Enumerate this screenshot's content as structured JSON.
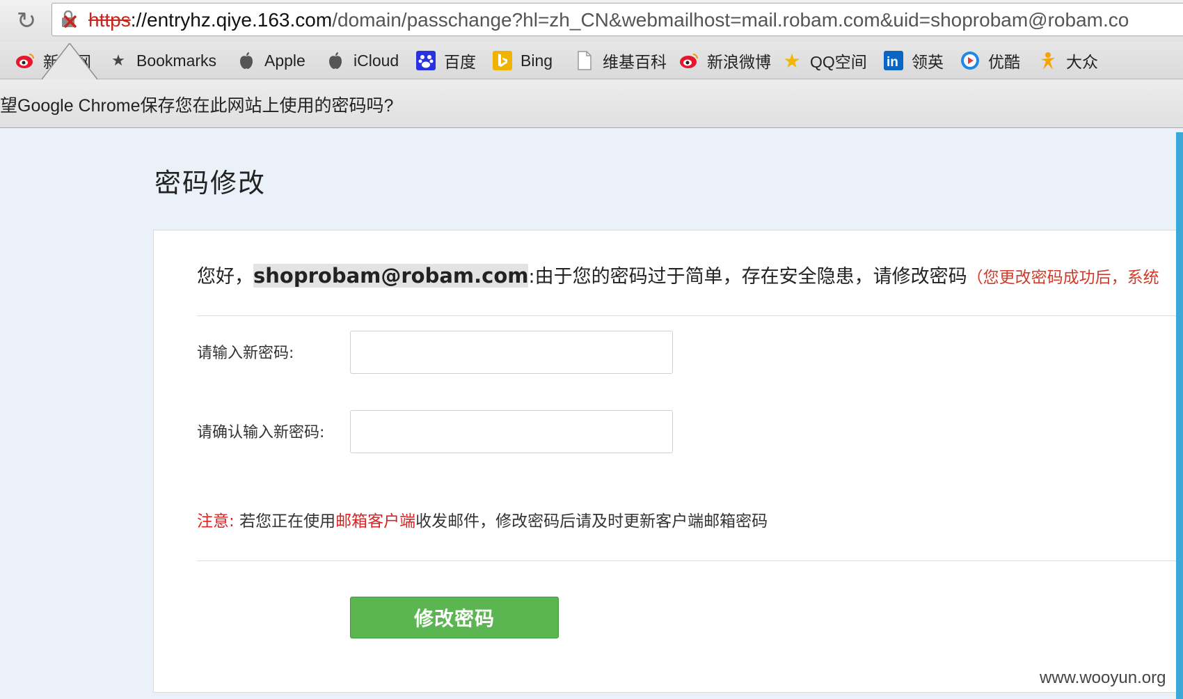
{
  "browser": {
    "url": {
      "scheme": "https",
      "host": "://entryhz.qiye.163.com",
      "path": "/domain/passchange?hl=zh_CN&webmailhost=mail.robam.com&uid=shoprobam@robam.co"
    },
    "bookmarks": [
      {
        "label": "新浪网",
        "icon": "weibo-icon"
      },
      {
        "label": "Bookmarks",
        "icon": "star-icon"
      },
      {
        "label": "Apple",
        "icon": "apple-icon"
      },
      {
        "label": "iCloud",
        "icon": "apple-icon"
      },
      {
        "label": "百度",
        "icon": "baidu-paw-icon"
      },
      {
        "label": "Bing",
        "icon": "bing-icon"
      },
      {
        "label": "维基百科",
        "icon": "page-icon"
      },
      {
        "label": "新浪微博",
        "icon": "weibo-icon"
      },
      {
        "label": "QQ空间",
        "icon": "qzone-star-icon"
      },
      {
        "label": "领英",
        "icon": "linkedin-icon"
      },
      {
        "label": "优酷",
        "icon": "youku-icon"
      },
      {
        "label": "大众",
        "icon": "person-icon"
      }
    ],
    "infobar_text": "望Google Chrome保存您在此网站上使用的密码吗?"
  },
  "page": {
    "title": "密码修改",
    "greeting_prefix": "您好，",
    "email": "shoprobam@robam.com",
    "greeting_suffix": ":由于您的密码过于简单，存在安全隐患，请修改密码",
    "greeting_note": "（您更改密码成功后，系统",
    "new_password_label": "请输入新密码:",
    "confirm_password_label": "请确认输入新密码:",
    "new_password_value": "",
    "confirm_password_value": "",
    "warning_prefix": "注意:",
    "warning_text_1": "若您正在使用",
    "warning_link": "邮箱客户端",
    "warning_text_2": "收发邮件，修改密码后请及时更新客户端邮箱密码",
    "submit_label": "修改密码",
    "watermark": "www.wooyun.org"
  },
  "colors": {
    "accent_red": "#e02020",
    "button_green": "#5bb651",
    "page_bg": "#eaf1f8"
  }
}
